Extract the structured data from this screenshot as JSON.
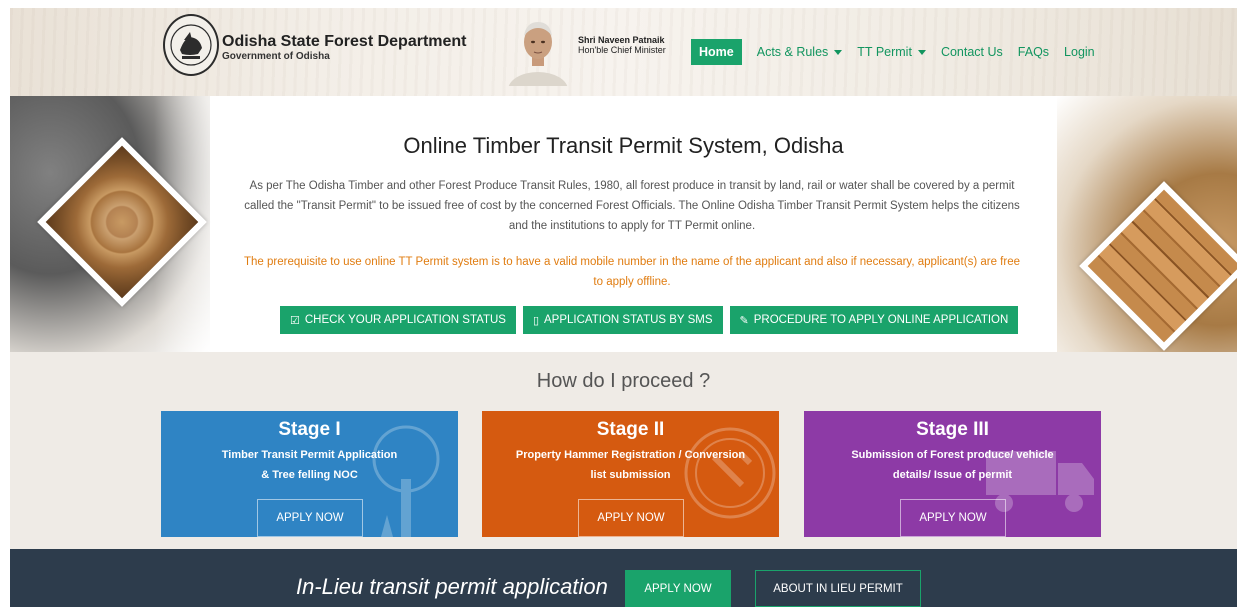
{
  "header": {
    "logo_title": "Odisha State Forest Department",
    "logo_subtitle": "Government of Odisha",
    "cm_name": "Shri Naveen Patnaik",
    "cm_title": "Hon'ble Chief Minister"
  },
  "nav": {
    "items": [
      {
        "label": "Home",
        "active": true,
        "dropdown": false
      },
      {
        "label": "Acts & Rules",
        "active": false,
        "dropdown": true
      },
      {
        "label": "TT Permit",
        "active": false,
        "dropdown": true
      },
      {
        "label": "Contact Us",
        "active": false,
        "dropdown": false
      },
      {
        "label": "FAQs",
        "active": false,
        "dropdown": false
      },
      {
        "label": "Login",
        "active": false,
        "dropdown": false
      }
    ]
  },
  "hero": {
    "title": "Online Timber Transit Permit System, Odisha",
    "description": "As per The Odisha Timber and other Forest Produce Transit Rules, 1980, all forest produce in transit by land, rail or water shall be covered by a permit called the \"Transit Permit\" to be issued free of cost by the concerned Forest Officials. The Online Odisha Timber Transit Permit System helps the citizens and the institutions to apply for TT Permit online.",
    "note": "The prerequisite to use online TT Permit system is to have a valid mobile number in the name of the applicant and also if necessary, applicant(s) are free to apply offline.",
    "buttons": [
      {
        "icon": "☑",
        "label": "CHECK YOUR APPLICATION STATUS"
      },
      {
        "icon": "▯",
        "label": "APPLICATION STATUS BY SMS"
      },
      {
        "icon": "✎",
        "label": "PROCEDURE TO APPLY ONLINE APPLICATION"
      }
    ]
  },
  "proceed": {
    "title": "How do I proceed ?",
    "stages": [
      {
        "name": "Stage I",
        "desc_line1": "Timber Transit Permit Application",
        "desc_line2": "& Tree felling NOC",
        "button": "APPLY NOW",
        "color": "#2f84c4"
      },
      {
        "name": "Stage II",
        "desc_line1": "Property Hammer Registration / Conversion",
        "desc_line2": "list submission",
        "button": "APPLY NOW",
        "color": "#d55a10"
      },
      {
        "name": "Stage III",
        "desc_line1": "Submission of Forest produce/ vehicle",
        "desc_line2": "details/ Issue of permit",
        "button": "APPLY NOW",
        "color": "#8d3aa6"
      }
    ]
  },
  "lieu": {
    "title": "In-Lieu transit permit application",
    "apply_button": "APPLY NOW",
    "about_button": "ABOUT IN LIEU PERMIT"
  },
  "colors": {
    "accent_green": "#1aa36b",
    "note_orange": "#e07c10",
    "footer_navy": "#2d3c4c"
  }
}
